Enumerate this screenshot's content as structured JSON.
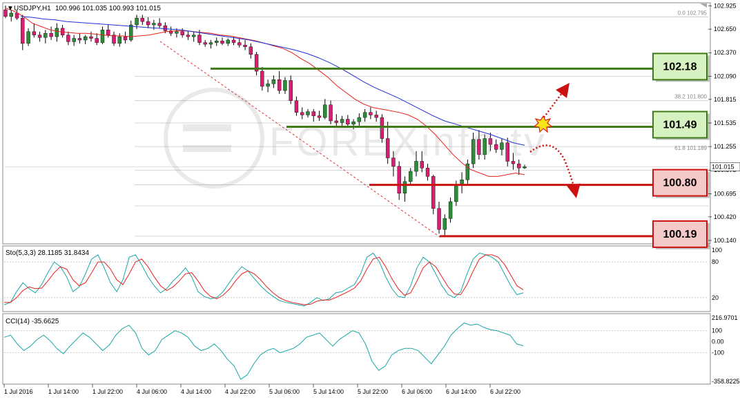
{
  "chart_data": {
    "type": "candlestick",
    "symbol": "USDJPY,H1",
    "ohlc_readout": "100.996 101.035 100.993 101.015",
    "current_price": "101.015",
    "ylim": [
      100.14,
      102.93
    ],
    "y_ticks": [
      "102.925",
      "102.650",
      "102.370",
      "102.090",
      "101.815",
      "101.535",
      "101.255",
      "100.975",
      "100.695",
      "100.420",
      "100.140"
    ],
    "x_ticks": [
      "1 Jul 2016",
      "1 Jul 14:00",
      "1 Jul 22:00",
      "4 Jul 06:00",
      "4 Jul 14:00",
      "4 Jul 22:00",
      "5 Jul 06:00",
      "5 Jul 14:00",
      "5 Jul 22:00",
      "6 Jul 06:00",
      "6 Jul 14:00",
      "6 Jul 22:00"
    ],
    "fib_levels": [
      {
        "label": "0.0  102.795",
        "value": 102.795
      },
      {
        "label": "38.2  101.800",
        "value": 101.8
      },
      {
        "label": "61.8  101.189",
        "value": 101.189
      }
    ],
    "key_levels": [
      {
        "label": "102.18",
        "value": 102.18,
        "kind": "resistance"
      },
      {
        "label": "101.49",
        "value": 101.49,
        "kind": "resistance"
      },
      {
        "label": "100.80",
        "value": 100.8,
        "kind": "support"
      },
      {
        "label": "100.19",
        "value": 100.19,
        "kind": "support"
      }
    ],
    "candles": [
      [
        102.88,
        102.93,
        102.78,
        102.8
      ],
      [
        102.8,
        102.88,
        102.74,
        102.84
      ],
      [
        102.84,
        102.87,
        102.76,
        102.78
      ],
      [
        102.78,
        102.82,
        102.4,
        102.48
      ],
      [
        102.48,
        102.66,
        102.45,
        102.62
      ],
      [
        102.62,
        102.72,
        102.55,
        102.58
      ],
      [
        102.58,
        102.62,
        102.5,
        102.55
      ],
      [
        102.55,
        102.64,
        102.48,
        102.6
      ],
      [
        102.6,
        102.68,
        102.52,
        102.56
      ],
      [
        102.56,
        102.72,
        102.5,
        102.66
      ],
      [
        102.66,
        102.7,
        102.55,
        102.58
      ],
      [
        102.58,
        102.62,
        102.46,
        102.5
      ],
      [
        102.5,
        102.58,
        102.45,
        102.54
      ],
      [
        102.54,
        102.6,
        102.48,
        102.52
      ],
      [
        102.52,
        102.58,
        102.47,
        102.56
      ],
      [
        102.56,
        102.62,
        102.5,
        102.54
      ],
      [
        102.54,
        102.6,
        102.46,
        102.49
      ],
      [
        102.49,
        102.68,
        102.47,
        102.64
      ],
      [
        102.64,
        102.7,
        102.55,
        102.58
      ],
      [
        102.58,
        102.62,
        102.45,
        102.48
      ],
      [
        102.48,
        102.6,
        102.44,
        102.56
      ],
      [
        102.56,
        102.62,
        102.48,
        102.52
      ],
      [
        102.52,
        102.75,
        102.5,
        102.7
      ],
      [
        102.7,
        102.82,
        102.65,
        102.78
      ],
      [
        102.78,
        102.82,
        102.7,
        102.74
      ],
      [
        102.74,
        102.79,
        102.66,
        102.7
      ],
      [
        102.7,
        102.76,
        102.64,
        102.72
      ],
      [
        102.72,
        102.78,
        102.66,
        102.69
      ],
      [
        102.69,
        102.73,
        102.6,
        102.63
      ],
      [
        102.63,
        102.68,
        102.57,
        102.6
      ],
      [
        102.6,
        102.66,
        102.55,
        102.62
      ],
      [
        102.62,
        102.66,
        102.55,
        102.58
      ],
      [
        102.58,
        102.63,
        102.52,
        102.56
      ],
      [
        102.56,
        102.62,
        102.5,
        102.58
      ],
      [
        102.58,
        102.64,
        102.46,
        102.49
      ],
      [
        102.49,
        102.52,
        102.44,
        102.47
      ],
      [
        102.47,
        102.52,
        102.42,
        102.49
      ],
      [
        102.49,
        102.55,
        102.45,
        102.51
      ],
      [
        102.51,
        102.55,
        102.46,
        102.48
      ],
      [
        102.48,
        102.54,
        102.45,
        102.52
      ],
      [
        102.52,
        102.56,
        102.46,
        102.49
      ],
      [
        102.49,
        102.54,
        102.43,
        102.46
      ],
      [
        102.46,
        102.52,
        102.4,
        102.44
      ],
      [
        102.44,
        102.48,
        102.3,
        102.35
      ],
      [
        102.35,
        102.38,
        102.1,
        102.15
      ],
      [
        102.15,
        102.2,
        101.92,
        101.97
      ],
      [
        101.97,
        102.05,
        101.9,
        102.0
      ],
      [
        102.0,
        102.1,
        101.95,
        102.05
      ],
      [
        102.05,
        102.15,
        101.88,
        101.92
      ],
      [
        101.92,
        102.08,
        101.88,
        102.04
      ],
      [
        102.04,
        102.1,
        101.76,
        101.8
      ],
      [
        101.8,
        101.85,
        101.62,
        101.66
      ],
      [
        101.66,
        101.72,
        101.58,
        101.63
      ],
      [
        101.63,
        101.7,
        101.6,
        101.67
      ],
      [
        101.67,
        101.7,
        101.55,
        101.62
      ],
      [
        101.62,
        101.68,
        101.56,
        101.6
      ],
      [
        101.6,
        101.82,
        101.58,
        101.75
      ],
      [
        101.75,
        101.8,
        101.52,
        101.56
      ],
      [
        101.56,
        101.64,
        101.5,
        101.54
      ],
      [
        101.54,
        101.62,
        101.5,
        101.58
      ],
      [
        101.58,
        101.63,
        101.49,
        101.52
      ],
      [
        101.52,
        101.58,
        101.46,
        101.55
      ],
      [
        101.55,
        101.65,
        101.5,
        101.6
      ],
      [
        101.6,
        101.7,
        101.55,
        101.66
      ],
      [
        101.66,
        101.72,
        101.58,
        101.63
      ],
      [
        101.63,
        101.68,
        101.55,
        101.6
      ],
      [
        101.6,
        101.64,
        101.3,
        101.35
      ],
      [
        101.35,
        101.55,
        101.05,
        101.12
      ],
      [
        101.12,
        101.2,
        100.9,
        101.02
      ],
      [
        101.02,
        101.08,
        100.62,
        100.7
      ],
      [
        100.7,
        100.9,
        100.6,
        100.84
      ],
      [
        100.84,
        101.0,
        100.8,
        100.96
      ],
      [
        100.96,
        101.2,
        100.9,
        101.08
      ],
      [
        101.08,
        101.2,
        100.95,
        101.0
      ],
      [
        101.0,
        101.05,
        100.85,
        100.9
      ],
      [
        100.9,
        100.92,
        100.45,
        100.52
      ],
      [
        100.52,
        100.6,
        100.22,
        100.27
      ],
      [
        100.27,
        100.45,
        100.18,
        100.4
      ],
      [
        100.4,
        100.65,
        100.35,
        100.6
      ],
      [
        100.6,
        100.85,
        100.55,
        100.8
      ],
      [
        100.8,
        100.95,
        100.7,
        100.86
      ],
      [
        100.86,
        101.1,
        100.8,
        101.05
      ],
      [
        101.05,
        101.42,
        101.0,
        101.34
      ],
      [
        101.34,
        101.45,
        101.1,
        101.16
      ],
      [
        101.16,
        101.4,
        101.1,
        101.35
      ],
      [
        101.35,
        101.42,
        101.2,
        101.28
      ],
      [
        101.28,
        101.34,
        101.18,
        101.22
      ],
      [
        101.22,
        101.35,
        101.15,
        101.3
      ],
      [
        101.3,
        101.36,
        101.02,
        101.08
      ],
      [
        101.08,
        101.18,
        100.98,
        101.05
      ],
      [
        101.05,
        101.1,
        100.92,
        101.0
      ],
      [
        101.0,
        101.04,
        100.99,
        101.015
      ]
    ],
    "ma_fast": [
      102.9,
      102.86,
      102.8,
      102.72,
      102.68,
      102.64,
      102.62,
      102.61,
      102.6,
      102.6,
      102.59,
      102.58,
      102.57,
      102.57,
      102.56,
      102.57,
      102.58,
      102.6,
      102.62,
      102.63,
      102.63,
      102.62,
      102.61,
      102.6,
      102.58,
      102.57,
      102.55,
      102.53,
      102.51,
      102.48,
      102.45,
      102.42,
      102.37,
      102.3,
      102.24,
      102.16,
      102.08,
      101.98,
      101.9,
      101.82,
      101.76,
      101.72,
      101.7,
      101.68,
      101.66,
      101.63,
      101.58,
      101.5,
      101.4,
      101.28,
      101.16,
      101.06,
      100.98,
      100.94,
      100.9,
      100.9,
      100.92,
      100.94,
      100.92
    ],
    "ma_slow": [
      102.8,
      102.79,
      102.77,
      102.76,
      102.74,
      102.73,
      102.72,
      102.71,
      102.7,
      102.69,
      102.68,
      102.67,
      102.66,
      102.65,
      102.64,
      102.62,
      102.6,
      102.58,
      102.56,
      102.54,
      102.52,
      102.49,
      102.46,
      102.43,
      102.4,
      102.36,
      102.31,
      102.25,
      102.18,
      102.1,
      102.02,
      101.95,
      101.89,
      101.83,
      101.76,
      101.69,
      101.62,
      101.56,
      101.52,
      101.48,
      101.44,
      101.4,
      101.35,
      101.3,
      101.27
    ],
    "stoch": {
      "label": "Sto(5,3,3) 28.1185 31.8434",
      "levels": [
        {
          "label": "100",
          "value": 100
        },
        {
          "label": "80",
          "value": 80
        },
        {
          "label": "20",
          "value": 20
        }
      ],
      "main": [
        8,
        12,
        30,
        45,
        35,
        28,
        42,
        62,
        80,
        72,
        55,
        30,
        38,
        60,
        85,
        92,
        70,
        45,
        30,
        50,
        88,
        92,
        75,
        55,
        40,
        28,
        35,
        48,
        58,
        70,
        55,
        30,
        22,
        18,
        20,
        30,
        45,
        60,
        72,
        65,
        52,
        40,
        30,
        22,
        15,
        12,
        10,
        8,
        6,
        12,
        20,
        15,
        18,
        28,
        30,
        36,
        42,
        60,
        88,
        95,
        80,
        55,
        35,
        22,
        20,
        40,
        70,
        88,
        80,
        60,
        40,
        25,
        20,
        30,
        60,
        85,
        95,
        92,
        88,
        80,
        60,
        40,
        25,
        28
      ],
      "signal": [
        12,
        12,
        20,
        32,
        38,
        35,
        36,
        48,
        62,
        72,
        68,
        50,
        40,
        45,
        62,
        80,
        80,
        68,
        50,
        42,
        60,
        80,
        85,
        72,
        55,
        40,
        32,
        38,
        48,
        60,
        62,
        48,
        32,
        22,
        18,
        24,
        34,
        48,
        60,
        65,
        60,
        50,
        38,
        28,
        20,
        15,
        12,
        10,
        8,
        9,
        14,
        16,
        16,
        20,
        25,
        30,
        36,
        48,
        68,
        85,
        88,
        72,
        52,
        35,
        24,
        28,
        48,
        70,
        80,
        72,
        55,
        38,
        26,
        25,
        42,
        65,
        85,
        92,
        92,
        88,
        76,
        58,
        40,
        33
      ]
    },
    "cci": {
      "label": "CCI(14) -35.6625",
      "levels": [
        {
          "label": "216.9701",
          "value": 216.9701
        },
        {
          "label": "100",
          "value": 100
        },
        {
          "label": "0.00",
          "value": 0
        },
        {
          "label": "-100",
          "value": -100
        },
        {
          "label": "-358.8225",
          "value": -358.8225
        }
      ],
      "values": [
        40,
        60,
        -20,
        -80,
        -40,
        20,
        60,
        10,
        -60,
        -110,
        -40,
        20,
        80,
        40,
        -20,
        -80,
        -30,
        60,
        120,
        150,
        80,
        -60,
        -120,
        -80,
        20,
        60,
        100,
        80,
        40,
        -40,
        -80,
        -60,
        -20,
        -80,
        -160,
        -220,
        -340,
        -300,
        -200,
        -120,
        -80,
        -60,
        -100,
        -80,
        -60,
        -20,
        40,
        60,
        80,
        20,
        -40,
        20,
        60,
        100,
        80,
        -20,
        -180,
        -260,
        -220,
        -120,
        -80,
        -60,
        -60,
        -80,
        -140,
        -200,
        -120,
        -40,
        60,
        120,
        170,
        150,
        160,
        130,
        110,
        100,
        80,
        60,
        -20,
        -35.6625
      ]
    }
  },
  "colors": {
    "bull": "#2e8b3a",
    "bear": "#d81e73",
    "ma_fast": "#e8201c",
    "ma_slow": "#1f2fd8",
    "resistance_line": "#3f7a14",
    "resistance_box_fill": "#d6f2c0",
    "support_line": "#cc1111",
    "support_box_fill": "#f6c9c9",
    "stoch_main": "#1aa6a6",
    "stoch_signal": "#e8201c",
    "cci": "#1aa6a6"
  }
}
